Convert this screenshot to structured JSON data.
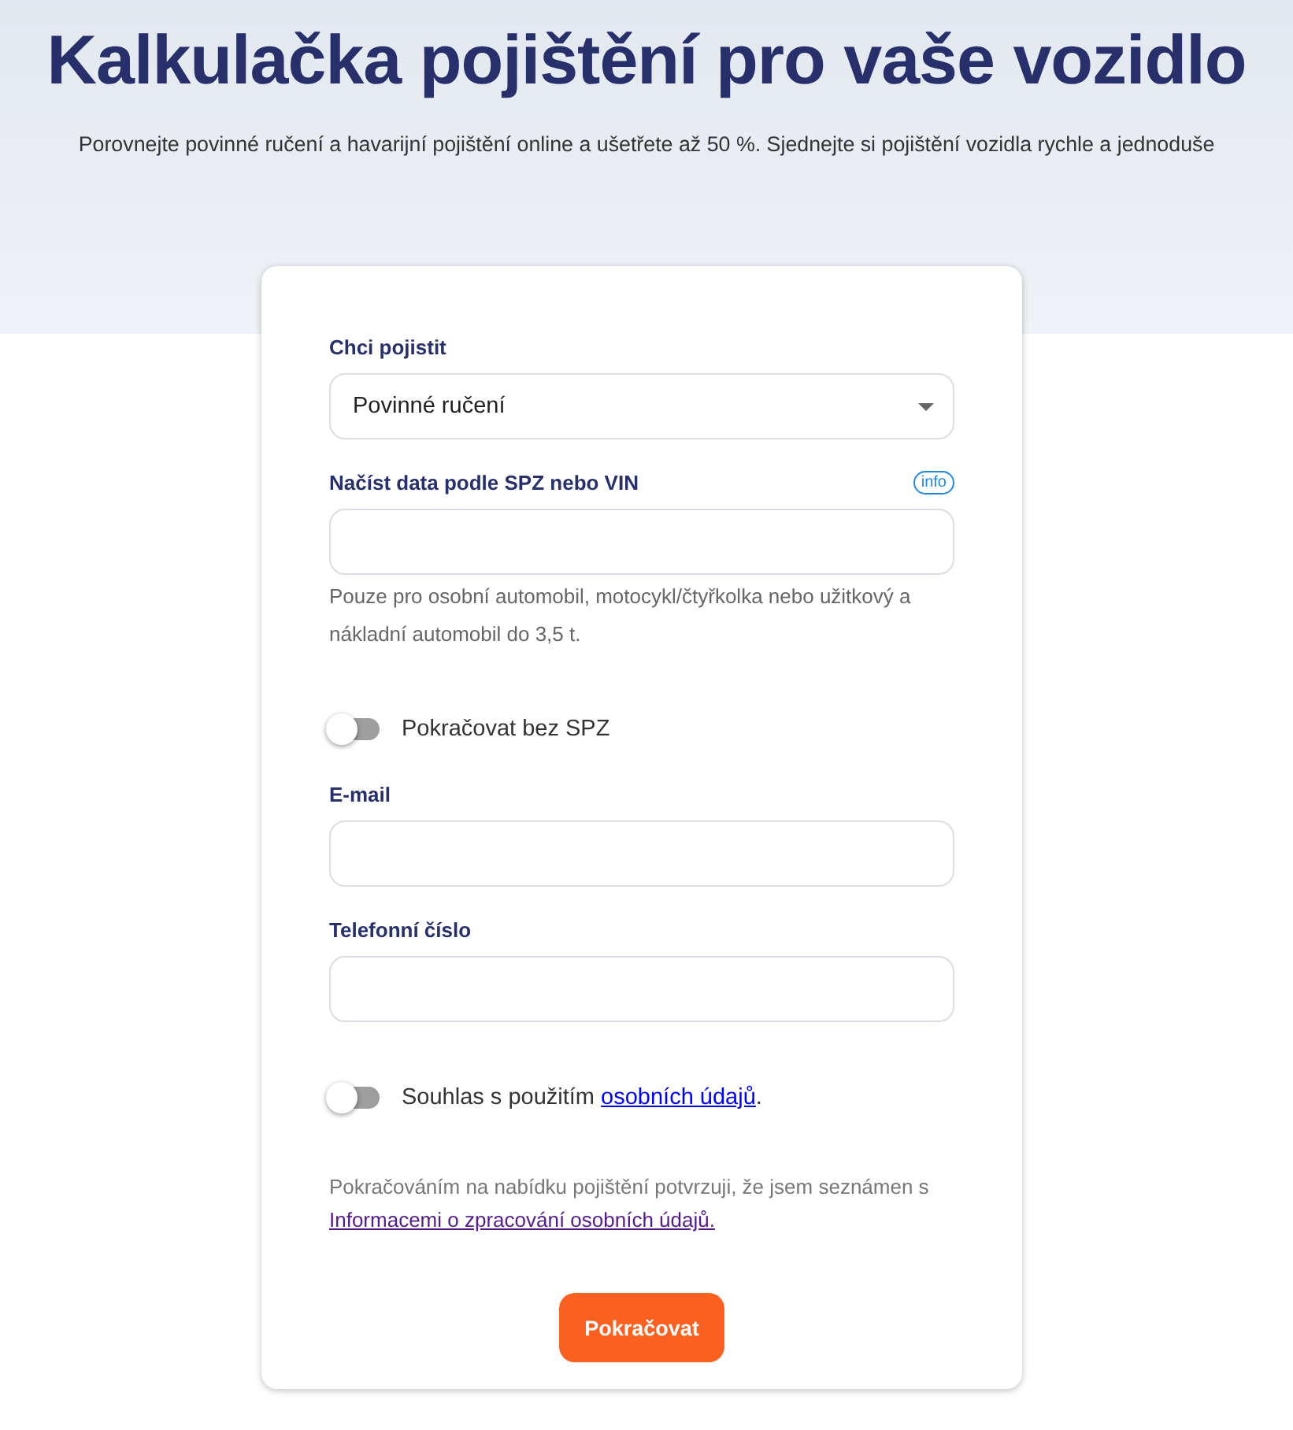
{
  "header": {
    "title": "Kalkulačka pojištění pro vaše vozidlo",
    "subtitle": "Porovnejte povinné ručení a havarijní pojištění online a ušetřete až 50 %. Sjednejte si pojištění vozidla rychle a jednoduše"
  },
  "form": {
    "fields": [
      {
        "kind": "select",
        "label": "Chci pojistit",
        "value": "Povinné ručení"
      },
      {
        "kind": "input",
        "label": "Načíst data podle SPZ nebo VIN",
        "info": "info",
        "hint": "Pouze pro osobní automobil, motocykl/čtyřkolka nebo užitkový a nákladní automobil do 3,5 t."
      },
      {
        "kind": "toggle",
        "on": false,
        "text": "Pokračovat bez SPZ"
      },
      {
        "kind": "input",
        "label": "E-mail"
      },
      {
        "kind": "input",
        "label": "Telefonní číslo"
      },
      {
        "kind": "toggle",
        "on": false,
        "text": "Souhlas s použitím ",
        "link": "osobních údajů",
        "after": "."
      }
    ],
    "note": {
      "text": "Pokračováním na nabídku pojištění potvrzuji, že jsem seznámen s ",
      "link": "Informacemi o zpracování osobních údajů."
    },
    "submit": "Pokračovat"
  }
}
